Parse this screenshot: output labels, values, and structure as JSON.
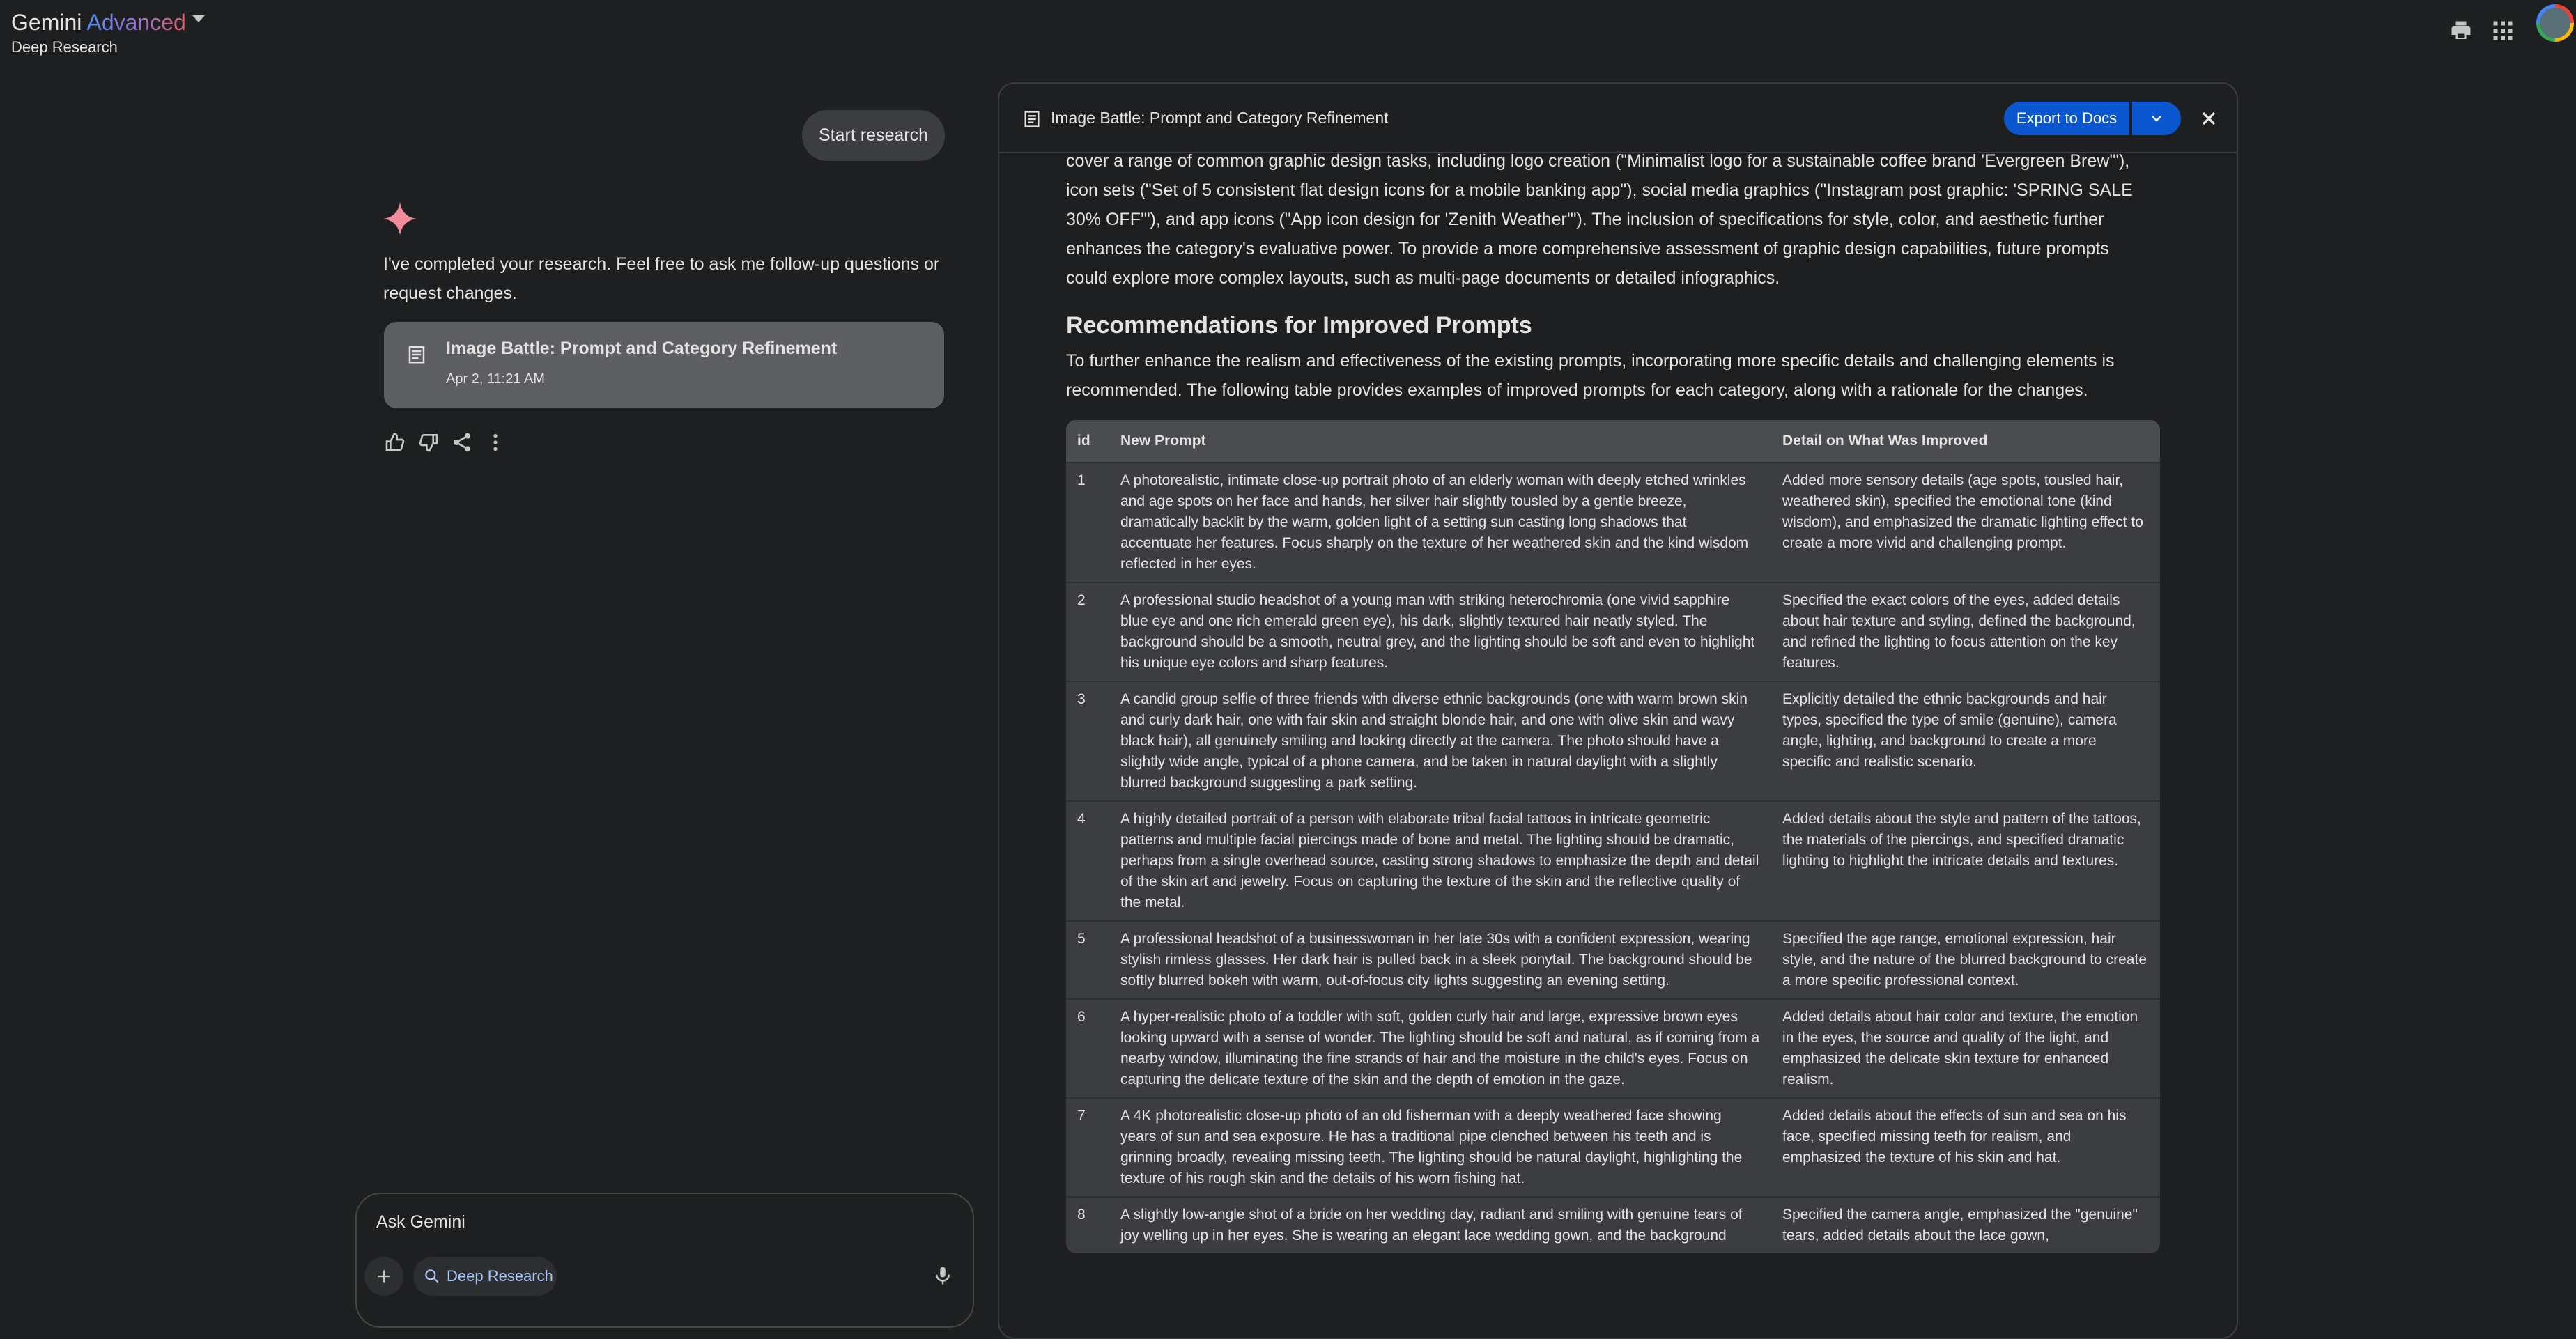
{
  "header": {
    "brand_main": "Gemini",
    "brand_accent": "Advanced",
    "subtitle": "Deep Research",
    "icons": [
      "print-icon",
      "apps-grid-icon",
      "account-avatar"
    ]
  },
  "chat": {
    "start_research_label": "Start research",
    "completion_message": "I've completed your research. Feel free to ask me follow-up questions or request changes.",
    "card_title": "Image Battle: Prompt and Category Refinement",
    "card_date": "Apr 2, 11:21 AM",
    "actions": [
      "thumbs-up-icon",
      "thumbs-down-icon",
      "share-icon",
      "more-vert-icon"
    ]
  },
  "input": {
    "placeholder": "Ask Gemini",
    "deep_research_chip": "Deep Research"
  },
  "panel": {
    "title": "Image Battle: Prompt and Category Refinement",
    "export_label": "Export to Docs",
    "intro_paragraph": "cover a range of common graphic design tasks, including logo creation (\"Minimalist logo for a sustainable coffee brand 'Evergreen Brew'\"), icon sets (\"Set of 5 consistent flat design icons for a mobile banking app\"), social media graphics (\"Instagram post graphic: 'SPRING SALE 30% OFF'\"), and app icons (\"App icon design for 'Zenith Weather'\"). The inclusion of specifications for style, color, and aesthetic further enhances the category's evaluative power. To provide a more comprehensive assessment of graphic design capabilities, future prompts could explore more complex layouts, such as multi-page documents or detailed infographics.",
    "section_heading": "Recommendations for Improved Prompts",
    "section_paragraph": "To further enhance the realism and effectiveness of the existing prompts, incorporating more specific details and challenging elements is recommended. The following table provides examples of improved prompts for each category, along with a rationale for the changes.",
    "table": {
      "headers": [
        "id",
        "New Prompt",
        "Detail on What Was Improved"
      ],
      "rows": [
        {
          "id": "1",
          "prompt": "A photorealistic, intimate close-up portrait photo of an elderly woman with deeply etched wrinkles and age spots on her face and hands, her silver hair slightly tousled by a gentle breeze, dramatically backlit by the warm, golden light of a setting sun casting long shadows that accentuate her features. Focus sharply on the texture of her weathered skin and the kind wisdom reflected in her eyes.",
          "detail": "Added more sensory details (age spots, tousled hair, weathered skin), specified the emotional tone (kind wisdom), and emphasized the dramatic lighting effect to create a more vivid and challenging prompt."
        },
        {
          "id": "2",
          "prompt": "A professional studio headshot of a young man with striking heterochromia (one vivid sapphire blue eye and one rich emerald green eye), his dark, slightly textured hair neatly styled. The background should be a smooth, neutral grey, and the lighting should be soft and even to highlight his unique eye colors and sharp features.",
          "detail": "Specified the exact colors of the eyes, added details about hair texture and styling, defined the background, and refined the lighting to focus attention on the key features."
        },
        {
          "id": "3",
          "prompt": "A candid group selfie of three friends with diverse ethnic backgrounds (one with warm brown skin and curly dark hair, one with fair skin and straight blonde hair, and one with olive skin and wavy black hair), all genuinely smiling and looking directly at the camera. The photo should have a slightly wide angle, typical of a phone camera, and be taken in natural daylight with a slightly blurred background suggesting a park setting.",
          "detail": "Explicitly detailed the ethnic backgrounds and hair types, specified the type of smile (genuine), camera angle, lighting, and background to create a more specific and realistic scenario."
        },
        {
          "id": "4",
          "prompt": "A highly detailed portrait of a person with elaborate tribal facial tattoos in intricate geometric patterns and multiple facial piercings made of bone and metal. The lighting should be dramatic, perhaps from a single overhead source, casting strong shadows to emphasize the depth and detail of the skin art and jewelry. Focus on capturing the texture of the skin and the reflective quality of the metal.",
          "detail": "Added details about the style and pattern of the tattoos, the materials of the piercings, and specified dramatic lighting to highlight the intricate details and textures."
        },
        {
          "id": "5",
          "prompt": "A professional headshot of a businesswoman in her late 30s with a confident expression, wearing stylish rimless glasses. Her dark hair is pulled back in a sleek ponytail. The background should be softly blurred bokeh with warm, out-of-focus city lights suggesting an evening setting.",
          "detail": "Specified the age range, emotional expression, hair style, and the nature of the blurred background to create a more specific professional context."
        },
        {
          "id": "6",
          "prompt": "A hyper-realistic photo of a toddler with soft, golden curly hair and large, expressive brown eyes looking upward with a sense of wonder. The lighting should be soft and natural, as if coming from a nearby window, illuminating the fine strands of hair and the moisture in the child's eyes. Focus on capturing the delicate texture of the skin and the depth of emotion in the gaze.",
          "detail": "Added details about hair color and texture, the emotion in the eyes, the source and quality of the light, and emphasized the delicate skin texture for enhanced realism."
        },
        {
          "id": "7",
          "prompt": "A 4K photorealistic close-up photo of an old fisherman with a deeply weathered face showing years of sun and sea exposure. He has a traditional pipe clenched between his teeth and is grinning broadly, revealing missing teeth. The lighting should be natural daylight, highlighting the texture of his rough skin and the details of his worn fishing hat.",
          "detail": "Added details about the effects of sun and sea on his face, specified missing teeth for realism, and emphasized the texture of his skin and hat."
        },
        {
          "id": "8",
          "prompt": "A slightly low-angle shot of a bride on her wedding day, radiant and smiling with genuine tears of joy welling up in her eyes. She is wearing an elegant lace wedding gown, and the background",
          "detail": "Specified the camera angle, emphasized the \"genuine\" tears, added details about the lace gown,"
        }
      ]
    }
  },
  "colors": {
    "background": "#1e1f20",
    "card": "#5d5f63",
    "accent_button": "#0b57d0",
    "sparkle": "#f28b9b",
    "table_bg": "#3c3d40"
  }
}
